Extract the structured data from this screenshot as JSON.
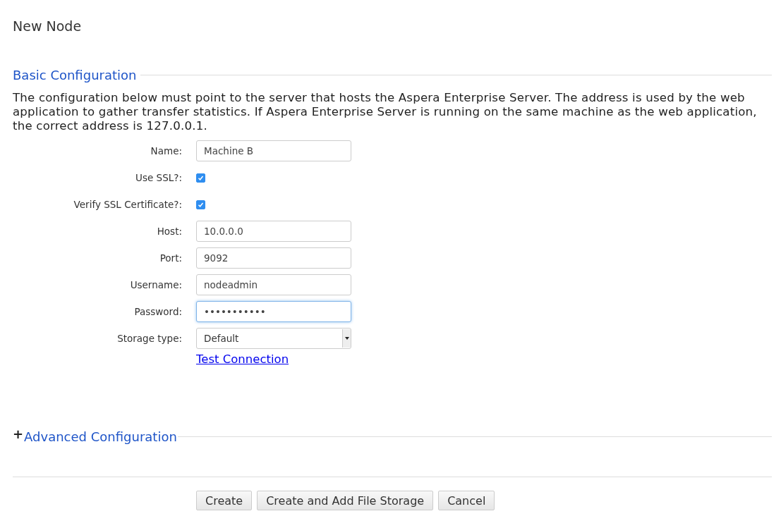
{
  "page_title": "New Node",
  "basic_section": {
    "title": "Basic Configuration",
    "description": "The configuration below must point to the server that hosts the Aspera Enterprise Server. The address is used by the web application to gather transfer statistics. If Aspera Enterprise Server is running on the same machine as the web application, the correct address is 127.0.0.1.",
    "fields": [
      {
        "kind": "text",
        "label": "Name:",
        "value": "Machine B",
        "focused": false
      },
      {
        "kind": "checkbox",
        "label": "Use SSL?:",
        "checked": true
      },
      {
        "kind": "checkbox",
        "label": "Verify SSL Certificate?:",
        "checked": true
      },
      {
        "kind": "text",
        "label": "Host:",
        "value": "10.0.0.0",
        "focused": false
      },
      {
        "kind": "text",
        "label": "Port:",
        "value": "9092",
        "focused": false
      },
      {
        "kind": "text",
        "label": "Username:",
        "value": "nodeadmin",
        "focused": false
      },
      {
        "kind": "text",
        "label": "Password:",
        "value": "•••••••••••",
        "focused": true
      },
      {
        "kind": "select",
        "label": "Storage type:",
        "value": "Default"
      }
    ],
    "test_link": "Test Connection"
  },
  "advanced_section": {
    "glyph": "+",
    "title": "Advanced Configuration"
  },
  "buttons": [
    "Create",
    "Create and Add File Storage",
    "Cancel"
  ]
}
